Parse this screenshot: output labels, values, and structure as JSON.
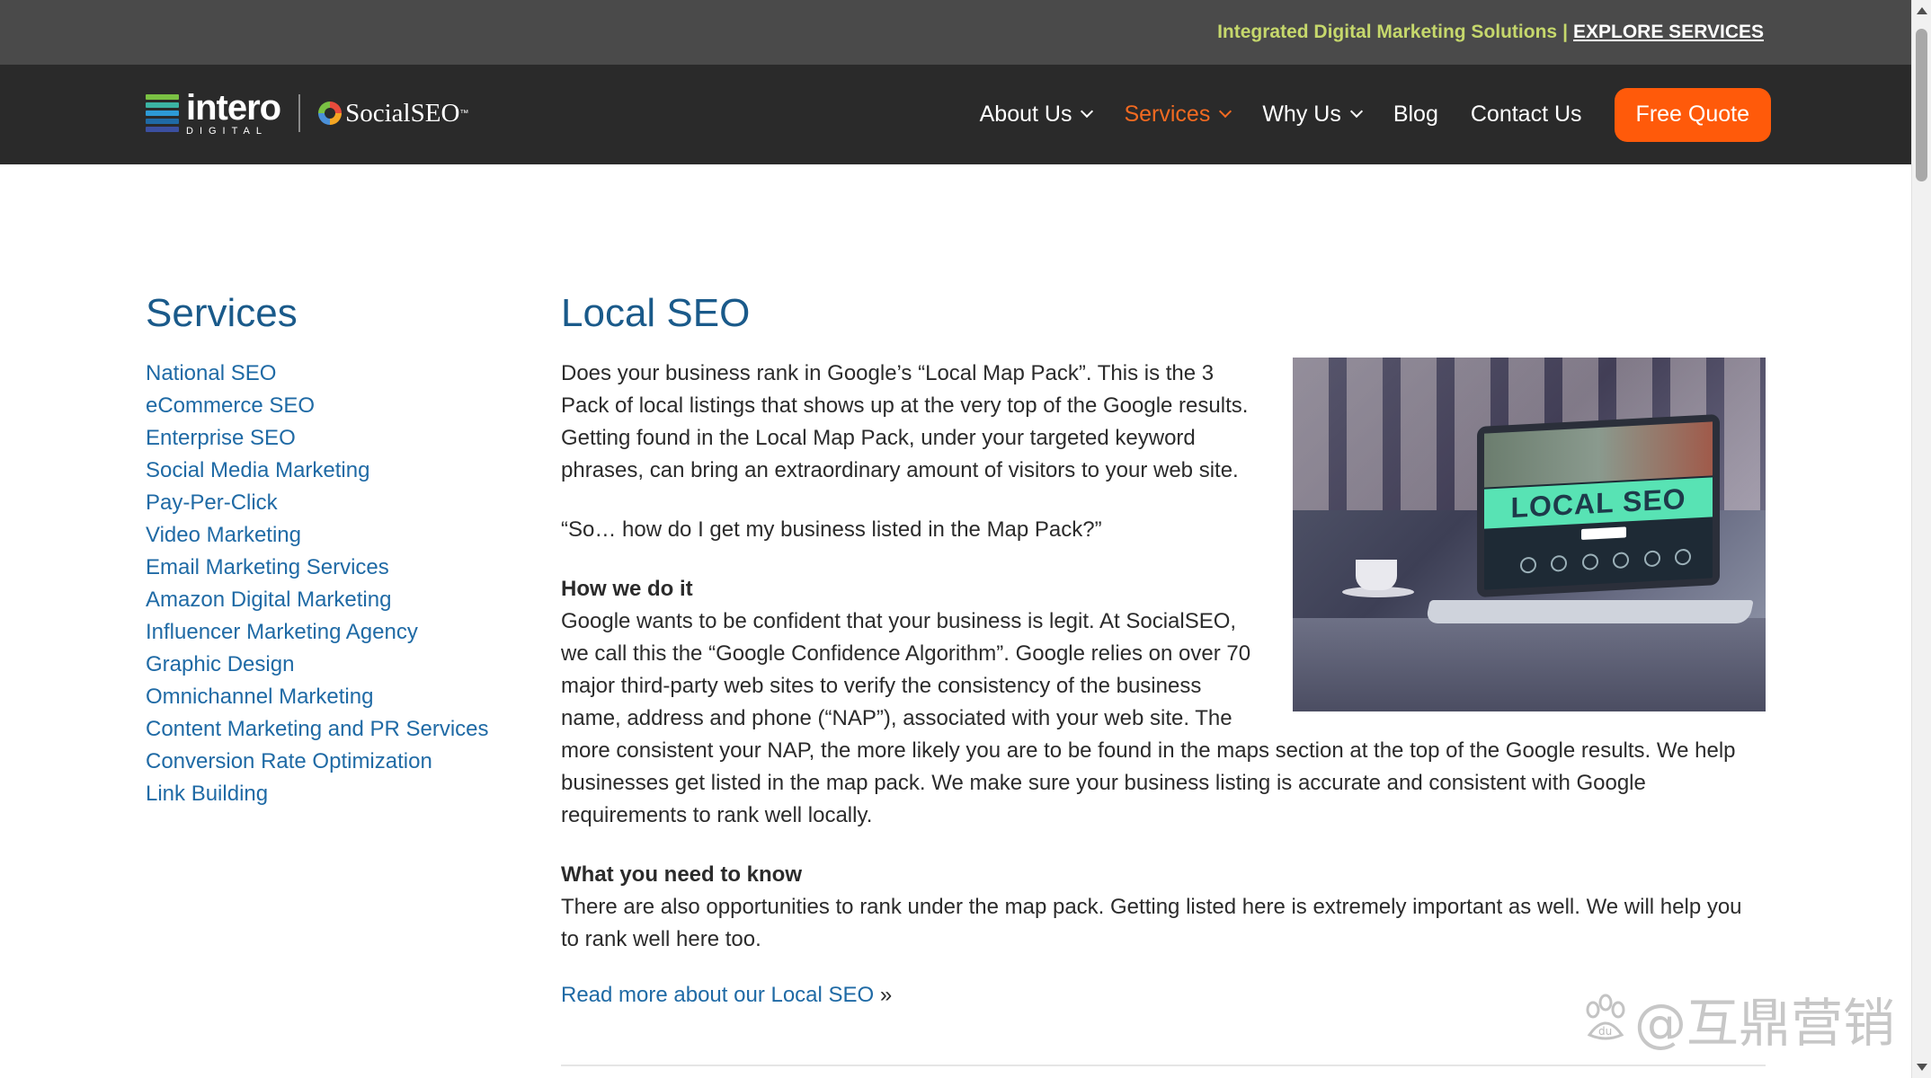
{
  "topbar": {
    "tagline": "Integrated Digital Marketing Solutions",
    "separator": "|",
    "explore_link": "EXPLORE SERVICES"
  },
  "nav": {
    "logo": {
      "primary": "intero",
      "primary_sub": "DIGITAL",
      "secondary": "SocialSEO",
      "secondary_tm": "™"
    },
    "menu": [
      {
        "label": "About Us",
        "has_dropdown": true,
        "active": false
      },
      {
        "label": "Services",
        "has_dropdown": true,
        "active": true
      },
      {
        "label": "Why Us",
        "has_dropdown": true,
        "active": false
      },
      {
        "label": "Blog",
        "has_dropdown": false,
        "active": false
      },
      {
        "label": "Contact Us",
        "has_dropdown": false,
        "active": false
      }
    ],
    "cta_label": "Free Quote"
  },
  "sidebar": {
    "title": "Services",
    "items": [
      "National SEO",
      "eCommerce SEO",
      "Enterprise SEO",
      "Social Media Marketing",
      "Pay-Per-Click",
      "Video Marketing",
      "Email Marketing Services",
      "Amazon Digital Marketing",
      "Influencer Marketing Agency",
      "Graphic Design",
      "Omnichannel Marketing",
      "Content Marketing and PR Services",
      "Conversion Rate Optimization",
      "Link Building"
    ]
  },
  "main": {
    "title": "Local SEO",
    "hero_image_text": "LOCAL SEO",
    "paragraph_1": "Does your business rank in Google’s “Local Map Pack”.  This is the 3 Pack of local listings that shows up at the very top of the Google results.  Getting found in the Local Map Pack, under your targeted keyword phrases, can bring an extraordinary amount of visitors to your web site.",
    "paragraph_2": "“So… how do I get my business listed in the Map Pack?”",
    "section_1_heading": "How we do it",
    "section_1_body": "Google wants to be confident that your business is legit.  At SocialSEO, we call this the “Google Confidence Algorithm”.  Google relies on over 70 major third-party web sites to verify the consistency of the business name, address and phone (“NAP”), associated with your web site.  The more consistent your NAP, the more likely you are to be found in the maps section at the top of the Google results.  We help businesses get listed in the map pack.  We make sure your business listing is accurate and consistent with Google requirements to rank well locally.",
    "section_2_heading": "What you need to know",
    "section_2_body": "There are also opportunities to rank under the map pack.  Getting listed here is extremely important as well.  We will help you to rank well here too.",
    "read_more": "Read more about our Local SEO",
    "read_more_suffix": " »"
  },
  "watermark": {
    "text": "@互鼎营销",
    "paw_text": "du"
  },
  "colors": {
    "accent_orange": "#ff5a0a",
    "link_blue": "#1f6aa5",
    "heading_blue": "#1a5a8a",
    "tagline_green": "#c6d86c",
    "nav_bg": "#2a2a2a",
    "topbar_bg": "#4a4a4a"
  },
  "icons": [
    "chevron-down-icon",
    "logo-bars-icon",
    "socialseo-ring-icon",
    "paw-icon"
  ]
}
